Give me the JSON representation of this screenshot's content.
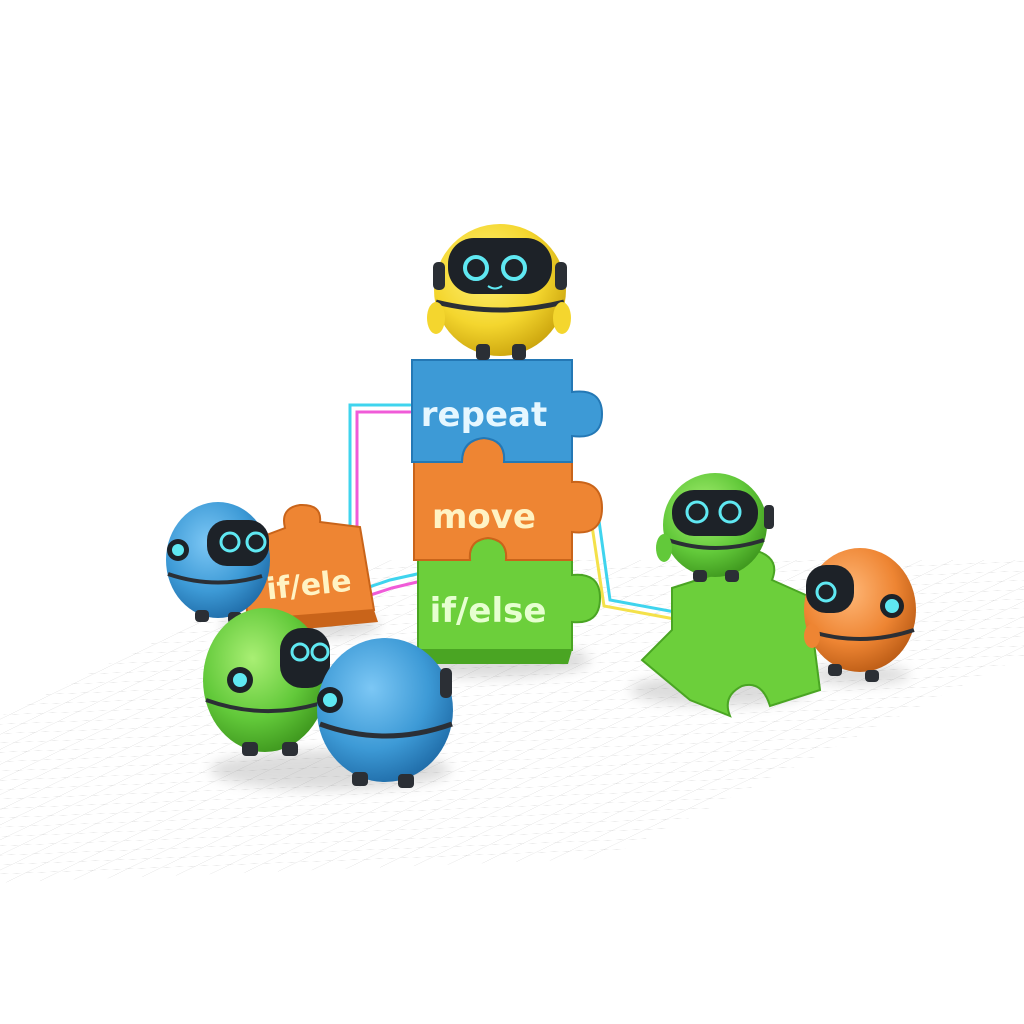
{
  "blocks": {
    "repeat": {
      "label": "repeat",
      "color": "#3d9ad6"
    },
    "move": {
      "label": "move",
      "color": "#ee8533"
    },
    "ifelse": {
      "label": "if/else",
      "color": "#6ccf3b"
    },
    "loose_orange": {
      "label": "if/ele",
      "color": "#ee8533"
    }
  },
  "colors": {
    "robot_yellow": "#f4d62e",
    "robot_blue": "#3d9ad6",
    "robot_green": "#62c93a",
    "robot_orange": "#ee8533",
    "visor": "#1d2228",
    "eye_glow": "#5fe8f2",
    "wire_cyan": "#3fd4ee",
    "wire_magenta": "#f05bd8",
    "wire_yellow": "#f4e14a",
    "grid": "#dcdcdc"
  },
  "icons": [
    "robot-icon",
    "puzzle-piece-icon"
  ]
}
